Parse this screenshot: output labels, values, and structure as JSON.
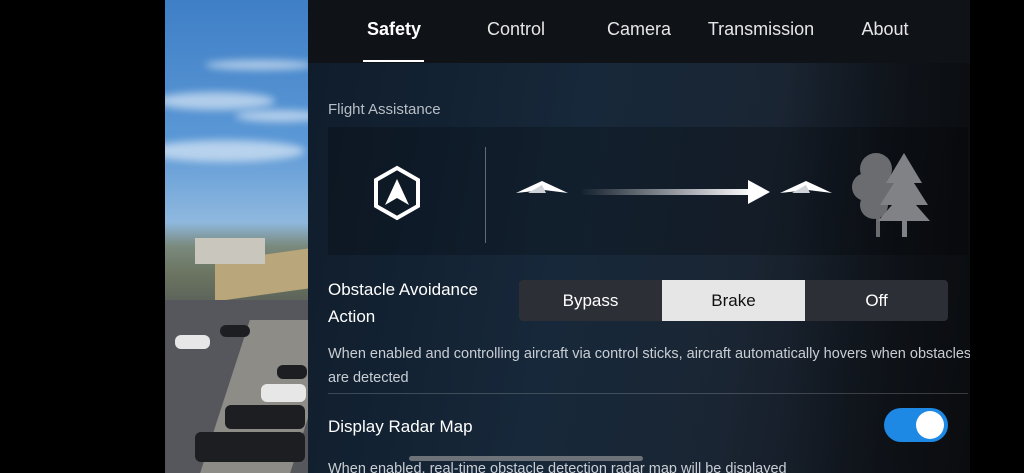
{
  "tabs": [
    {
      "label": "Safety",
      "active": true
    },
    {
      "label": "Control",
      "active": false
    },
    {
      "label": "Camera",
      "active": false
    },
    {
      "label": "Transmission",
      "active": false
    },
    {
      "label": "About",
      "active": false
    }
  ],
  "flight_assistance": {
    "section_label": "Flight Assistance",
    "icons": [
      "aircraft-shield-icon",
      "paper-plane-icon",
      "arrow-right-icon",
      "trees-icon"
    ]
  },
  "obstacle_avoidance": {
    "label": "Obstacle Avoidance Action",
    "options": [
      "Bypass",
      "Brake",
      "Off"
    ],
    "selected": "Brake",
    "description": "When enabled and controlling aircraft via control sticks, aircraft automatically hovers when obstacles are detected"
  },
  "radar_map": {
    "label": "Display Radar Map",
    "enabled": true,
    "description": "When enabled, real-time obstacle detection radar map will be displayed"
  },
  "colors": {
    "accent": "#1e88e5",
    "selected_segment": "#e6e6e6",
    "segment_bg": "#2c2f35"
  }
}
